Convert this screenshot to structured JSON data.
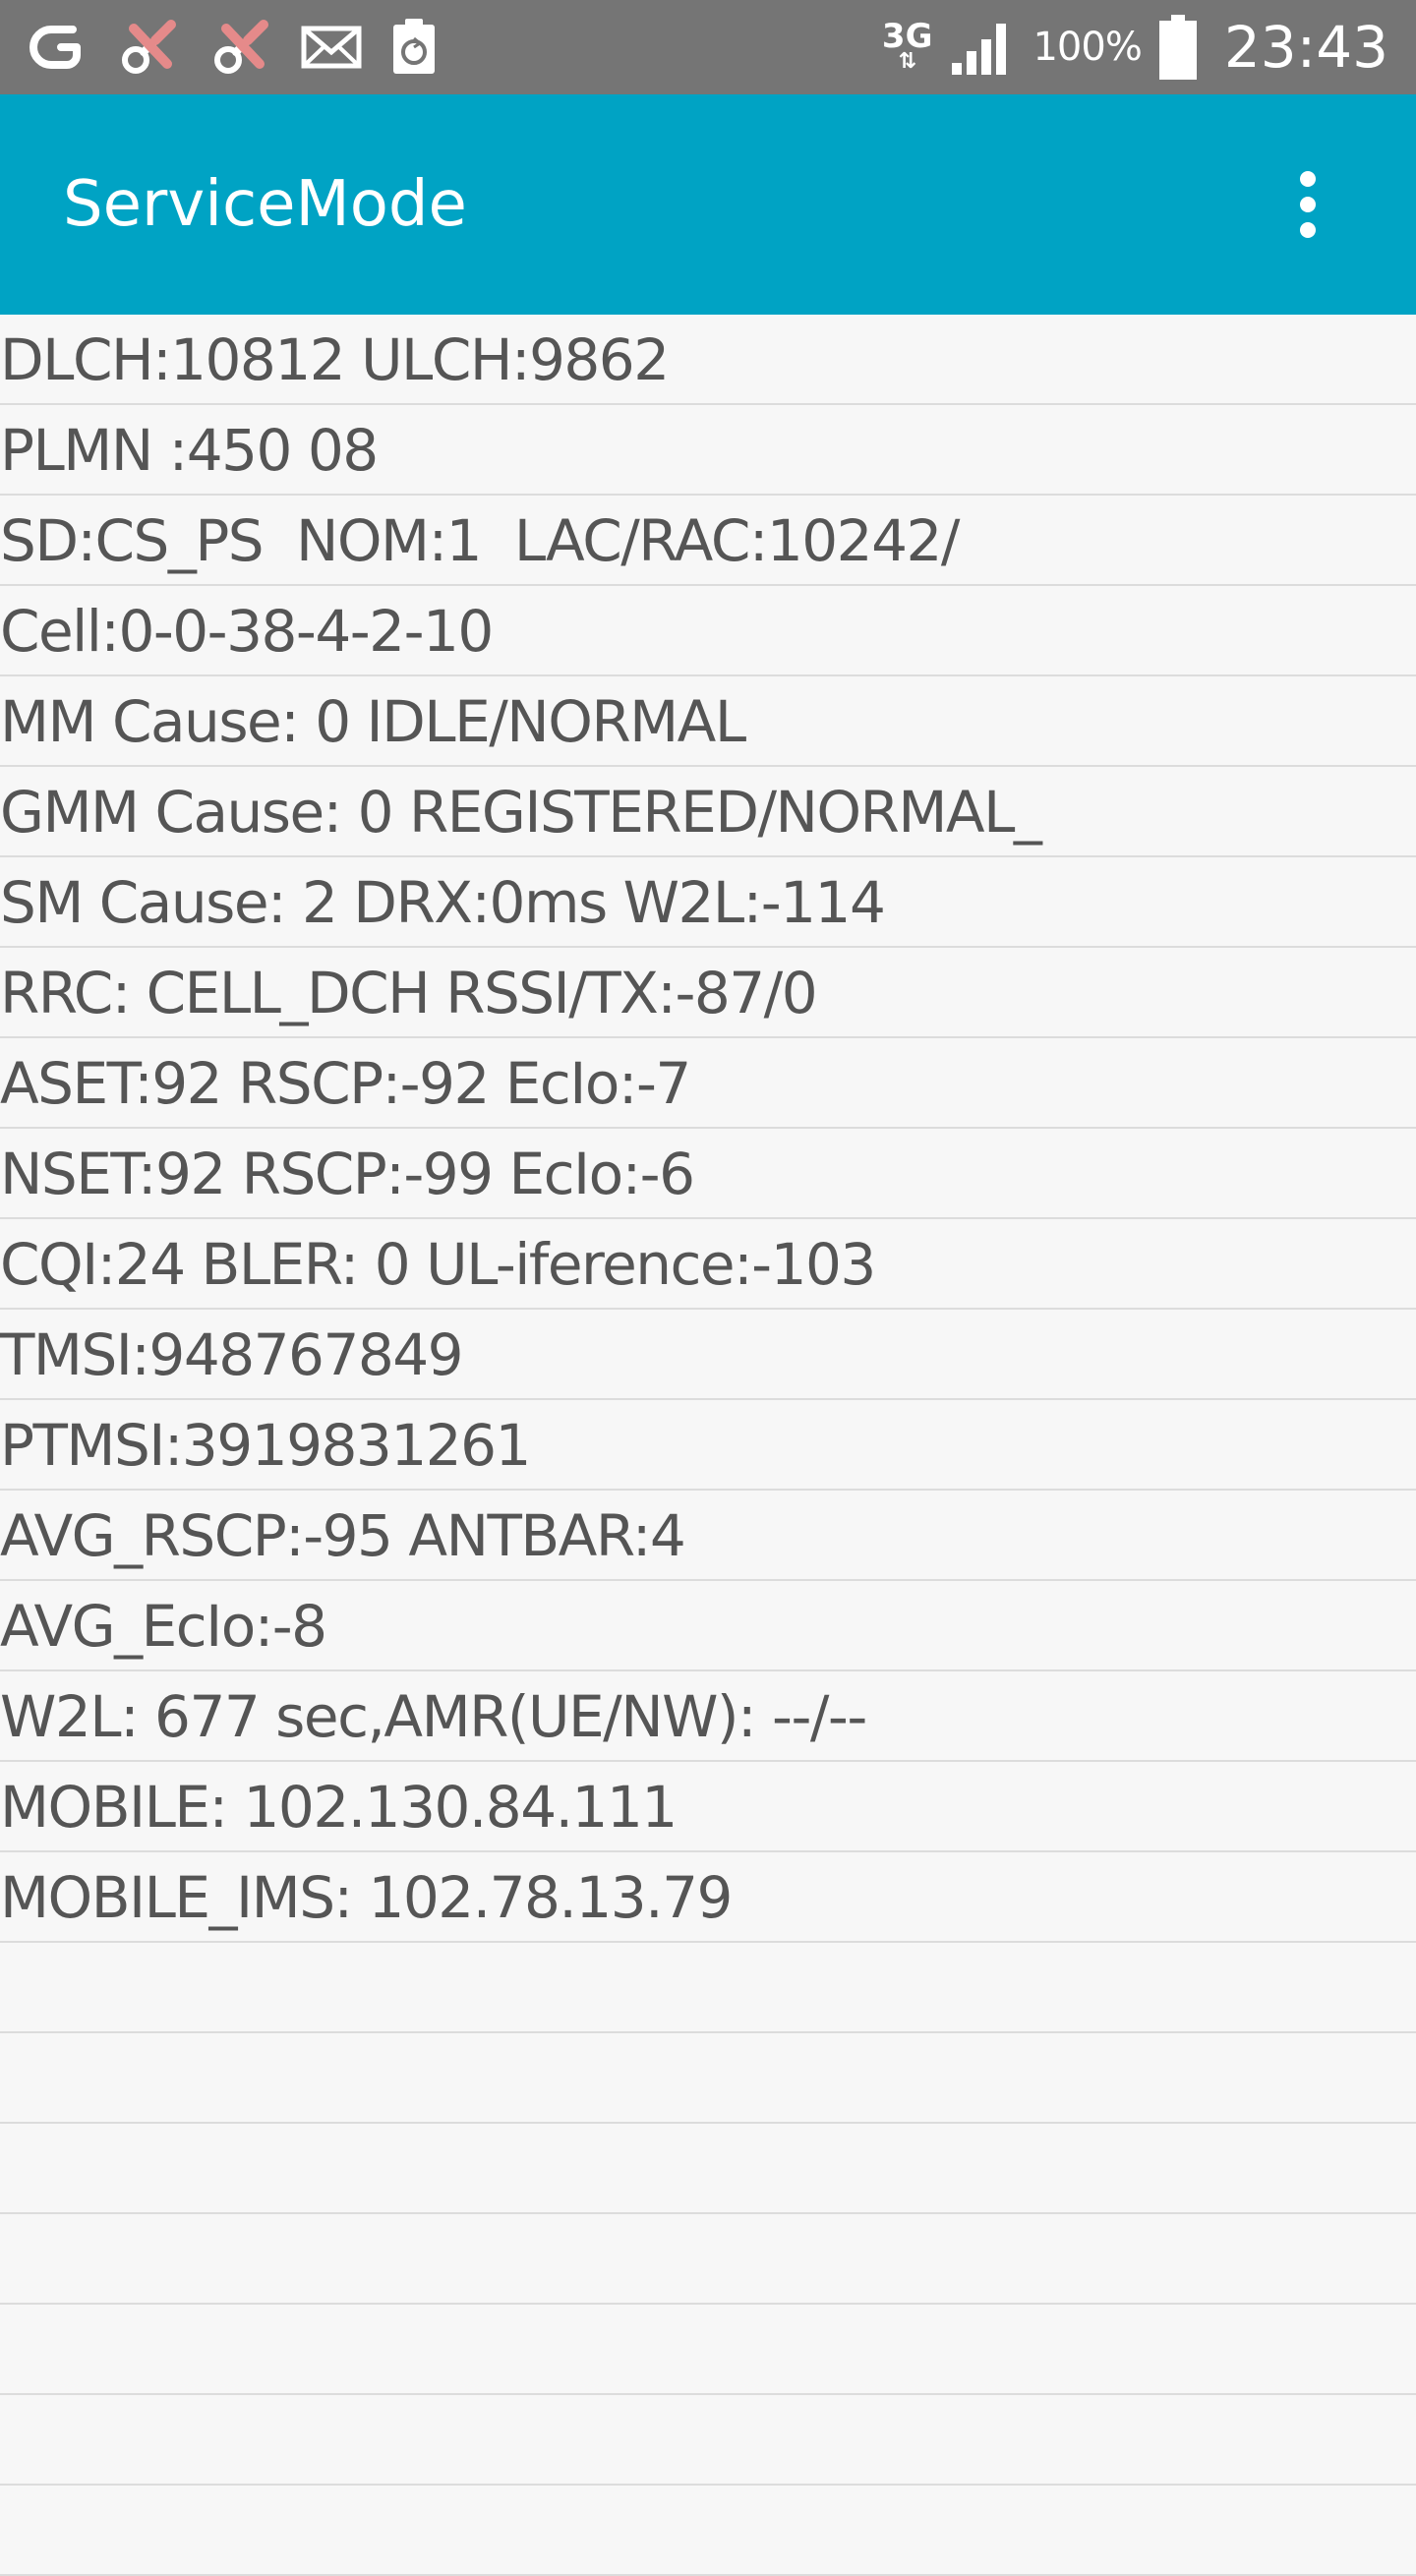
{
  "status_bar": {
    "left_icons": [
      "app-g-icon",
      "tools-icon",
      "tools-icon",
      "mail-icon",
      "recycle-clipboard-icon"
    ],
    "network_type": "3G",
    "battery_percent": "100%",
    "time": "23:43"
  },
  "app_bar": {
    "title": "ServiceMode",
    "menu_icon": "more-vert-icon",
    "color": "#00a3c4"
  },
  "rows": [
    "DLCH:10812 ULCH:9862",
    "PLMN :450 08",
    "SD:CS_PS  NOM:1  LAC/RAC:10242/",
    "Cell:0-0-38-4-2-10",
    "MM Cause: 0 IDLE/NORMAL",
    "GMM Cause: 0 REGISTERED/NORMAL_",
    "SM Cause: 2 DRX:0ms W2L:-114",
    "RRC: CELL_DCH RSSI/TX:-87/0",
    "ASET:92 RSCP:-92 EcIo:-7",
    "NSET:92 RSCP:-99 EcIo:-6",
    "CQI:24 BLER: 0 UL-iference:-103",
    "TMSI:948767849",
    "PTMSI:3919831261",
    "AVG_RSCP:-95 ANTBAR:4",
    "AVG_EcIo:-8",
    "W2L: 677 sec,AMR(UE/NW): --/--",
    "MOBILE: 102.130.84.111",
    "MOBILE_IMS: 102.78.13.79",
    "",
    "",
    "",
    "",
    "",
    "",
    ""
  ]
}
